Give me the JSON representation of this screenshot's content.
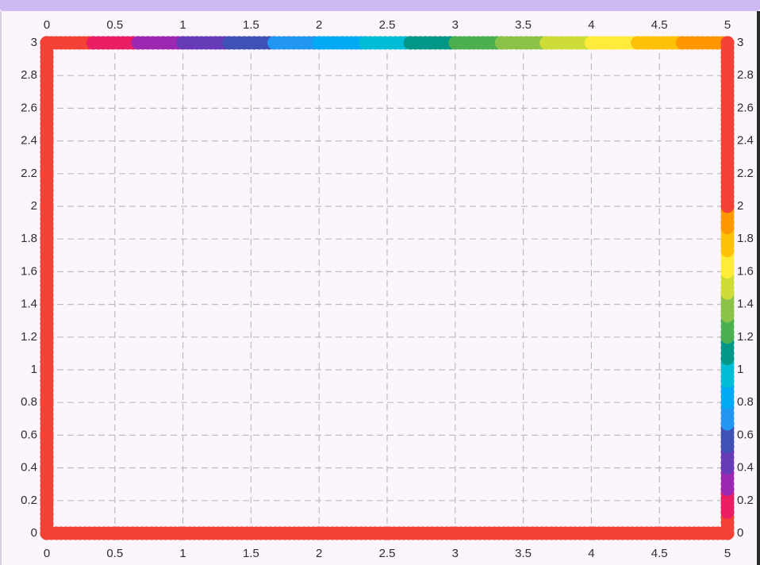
{
  "chart_data": {
    "type": "scatter",
    "title": "",
    "xlabel": "",
    "ylabel": "",
    "xlim": [
      0,
      5
    ],
    "ylim": [
      0,
      3
    ],
    "grid": true,
    "grid_style": "dashed",
    "x_ticks": [
      "0",
      "0.5",
      "1",
      "1.5",
      "2",
      "2.5",
      "3",
      "3.5",
      "4",
      "4.5",
      "5"
    ],
    "y_ticks": [
      "0",
      "0.2",
      "0.4",
      "0.6",
      "0.8",
      "1",
      "1.2",
      "1.4",
      "1.6",
      "1.8",
      "2",
      "2.2",
      "2.4",
      "2.6",
      "2.8",
      "3"
    ],
    "axes_shown": [
      "bottom",
      "top",
      "left",
      "right"
    ],
    "series": [
      {
        "color": "#f44336",
        "x": [
          0,
          0,
          0,
          0,
          0,
          0,
          0,
          0,
          0,
          0,
          0,
          0,
          0,
          0,
          0,
          0,
          0.5,
          1,
          1.5,
          2,
          2.5,
          3,
          3.5,
          4,
          4.5,
          5
        ],
        "y": [
          0,
          0.2,
          0.4,
          0.6,
          0.8,
          1,
          1.2,
          1.4,
          1.6,
          1.8,
          2,
          2.2,
          2.4,
          2.6,
          2.8,
          3,
          0,
          0,
          0,
          0,
          0,
          0,
          0,
          0,
          0,
          0
        ]
      }
    ],
    "color_segments": [
      {
        "color": "#f44336",
        "top_x": [
          0,
          0.34
        ],
        "right_y": [
          0,
          0.13
        ]
      },
      {
        "color": "#e91e63",
        "top_x": [
          0.34,
          0.67
        ],
        "right_y": [
          0.13,
          0.27
        ]
      },
      {
        "color": "#9c27b0",
        "top_x": [
          0.67,
          1.0
        ],
        "right_y": [
          0.27,
          0.4
        ]
      },
      {
        "color": "#673ab7",
        "top_x": [
          1.0,
          1.34
        ],
        "right_y": [
          0.4,
          0.53
        ]
      },
      {
        "color": "#3f51b5",
        "top_x": [
          1.34,
          1.67
        ],
        "right_y": [
          0.53,
          0.67
        ]
      },
      {
        "color": "#2196f3",
        "top_x": [
          1.67,
          2.0
        ],
        "right_y": [
          0.67,
          0.8
        ]
      },
      {
        "color": "#03a9f4",
        "top_x": [
          2.0,
          2.34
        ],
        "right_y": [
          0.8,
          0.93
        ]
      },
      {
        "color": "#00bcd4",
        "top_x": [
          2.34,
          2.67
        ],
        "right_y": [
          0.93,
          1.07
        ]
      },
      {
        "color": "#009688",
        "top_x": [
          2.67,
          3.0
        ],
        "right_y": [
          1.07,
          1.2
        ]
      },
      {
        "color": "#4caf50",
        "top_x": [
          3.0,
          3.34
        ],
        "right_y": [
          1.2,
          1.33
        ]
      },
      {
        "color": "#8bc34a",
        "top_x": [
          3.34,
          3.67
        ],
        "right_y": [
          1.33,
          1.47
        ]
      },
      {
        "color": "#cddc39",
        "top_x": [
          3.67,
          4.0
        ],
        "right_y": [
          1.47,
          1.6
        ]
      },
      {
        "color": "#ffeb3b",
        "top_x": [
          4.0,
          4.34
        ],
        "right_y": [
          1.6,
          1.73
        ]
      },
      {
        "color": "#ffc107",
        "top_x": [
          4.34,
          4.67
        ],
        "right_y": [
          1.73,
          1.87
        ]
      },
      {
        "color": "#ff9800",
        "top_x": [
          4.67,
          5.0
        ],
        "right_y": [
          1.87,
          2.0
        ]
      },
      {
        "color": "#f44336",
        "top_x": [
          5.0,
          5.0
        ],
        "right_y": [
          2.0,
          3.0
        ]
      }
    ]
  }
}
